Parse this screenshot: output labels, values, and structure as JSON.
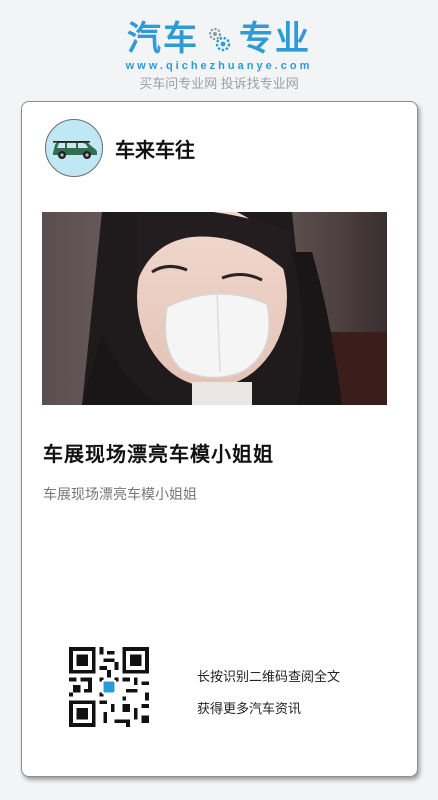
{
  "site": {
    "name_left": "汽车",
    "name_right": "专业",
    "url": "www.qichezhuanye.com",
    "slogan": "买车问专业网 投诉找专业网",
    "brand_color": "#2d9bd6"
  },
  "author": {
    "name": "车来车往",
    "avatar_icon": "car-icon"
  },
  "article": {
    "title": "车展现场漂亮车模小姐姐",
    "summary": "车展现场漂亮车模小姐姐"
  },
  "share": {
    "qr_caption_line1": "长按识别二维码查阅全文",
    "qr_caption_line2": "获得更多汽车资讯",
    "qr_icon": "qr-code-icon"
  }
}
